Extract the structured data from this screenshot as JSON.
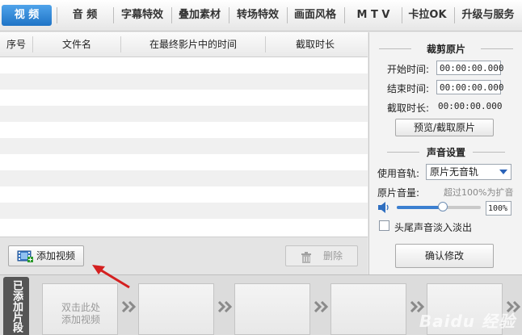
{
  "tabs": [
    "视 频",
    "音 频",
    "字幕特效",
    "叠加素材",
    "转场特效",
    "画面风格",
    "M T V",
    "卡拉OK",
    "升级与服务"
  ],
  "table": {
    "headers": [
      "序号",
      "文件名",
      "在最终影片中的时间",
      "截取时长"
    ],
    "rows": []
  },
  "left_buttons": {
    "add_video": "添加视频",
    "delete": "删除"
  },
  "trim": {
    "title": "裁剪原片",
    "start_label": "开始时间:",
    "start_value": "00:00:00.000",
    "end_label": "结束时间:",
    "end_value": "00:00:00.000",
    "duration_label": "截取时长:",
    "duration_value": "00:00:00.000",
    "preview_button": "预览/截取原片"
  },
  "audio": {
    "title": "声音设置",
    "track_label": "使用音轨:",
    "track_value": "原片无音轨",
    "volume_label": "原片音量:",
    "volume_hint": "超过100%为扩音",
    "volume_value": "100%",
    "volume_level": 0.55,
    "fade_label": "头尾声音淡入淡出",
    "confirm_button": "确认修改"
  },
  "filmstrip": {
    "label": "已添加片段",
    "placeholder_line1": "双击此处",
    "placeholder_line2": "添加视频"
  },
  "watermark": "Baidu 经验",
  "colors": {
    "active_tab": "#1f74c6",
    "arrow": "#d42020"
  }
}
